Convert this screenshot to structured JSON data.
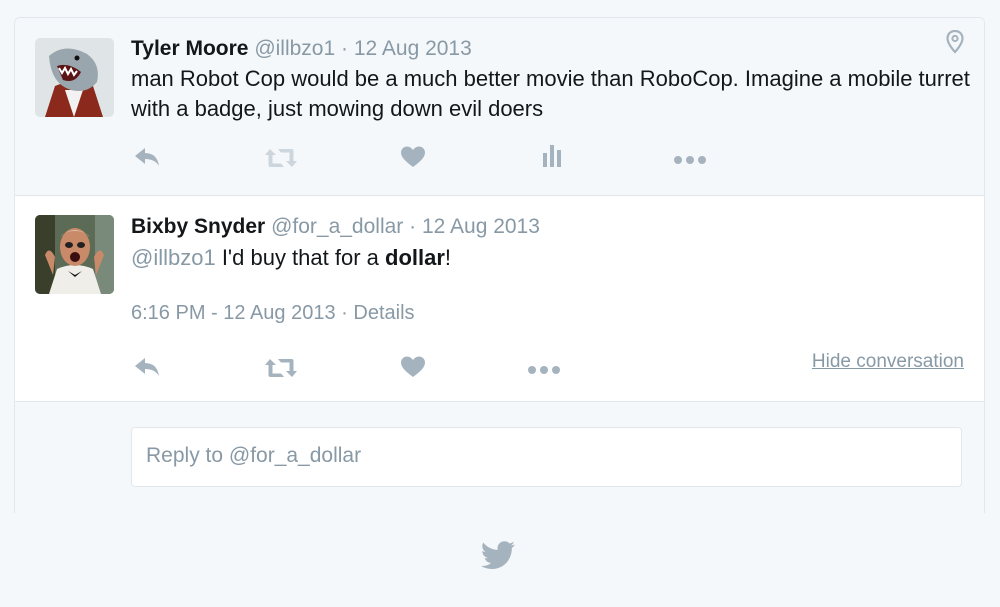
{
  "colors": {
    "background": "#f5f8fa",
    "border": "#e1e8ed",
    "meta_text": "#8899a6",
    "icon": "#a5b3bf"
  },
  "parent_tweet": {
    "name": "Tyler Moore",
    "handle": "@illbzo1",
    "separator": " · ",
    "date": "12 Aug 2013",
    "text": "man Robot Cop would be a much better movie than RoboCop. Imagine a mobile turret with a badge, just mowing down evil doers",
    "location_icon": "map-pin-icon",
    "actions": [
      "reply-icon",
      "retweet-icon",
      "heart-icon",
      "analytics-icon",
      "more-icon"
    ]
  },
  "reply_tweet": {
    "name": "Bixby Snyder",
    "handle": "@for_a_dollar",
    "separator": " · ",
    "date": "12 Aug 2013",
    "mention": "@illbzo1",
    "text_before": " I'd buy that for a ",
    "text_bold": "dollar",
    "text_after": "!",
    "timestamp": "6:16 PM - 12 Aug 2013",
    "timestamp_sep": " · ",
    "details_link": "Details",
    "actions": [
      "reply-icon",
      "retweet-icon",
      "heart-icon",
      "more-icon"
    ],
    "hide_conversation": "Hide conversation"
  },
  "reply_box": {
    "placeholder": "Reply to @for_a_dollar"
  },
  "footer": {
    "logo_icon": "twitter-bird-icon"
  }
}
